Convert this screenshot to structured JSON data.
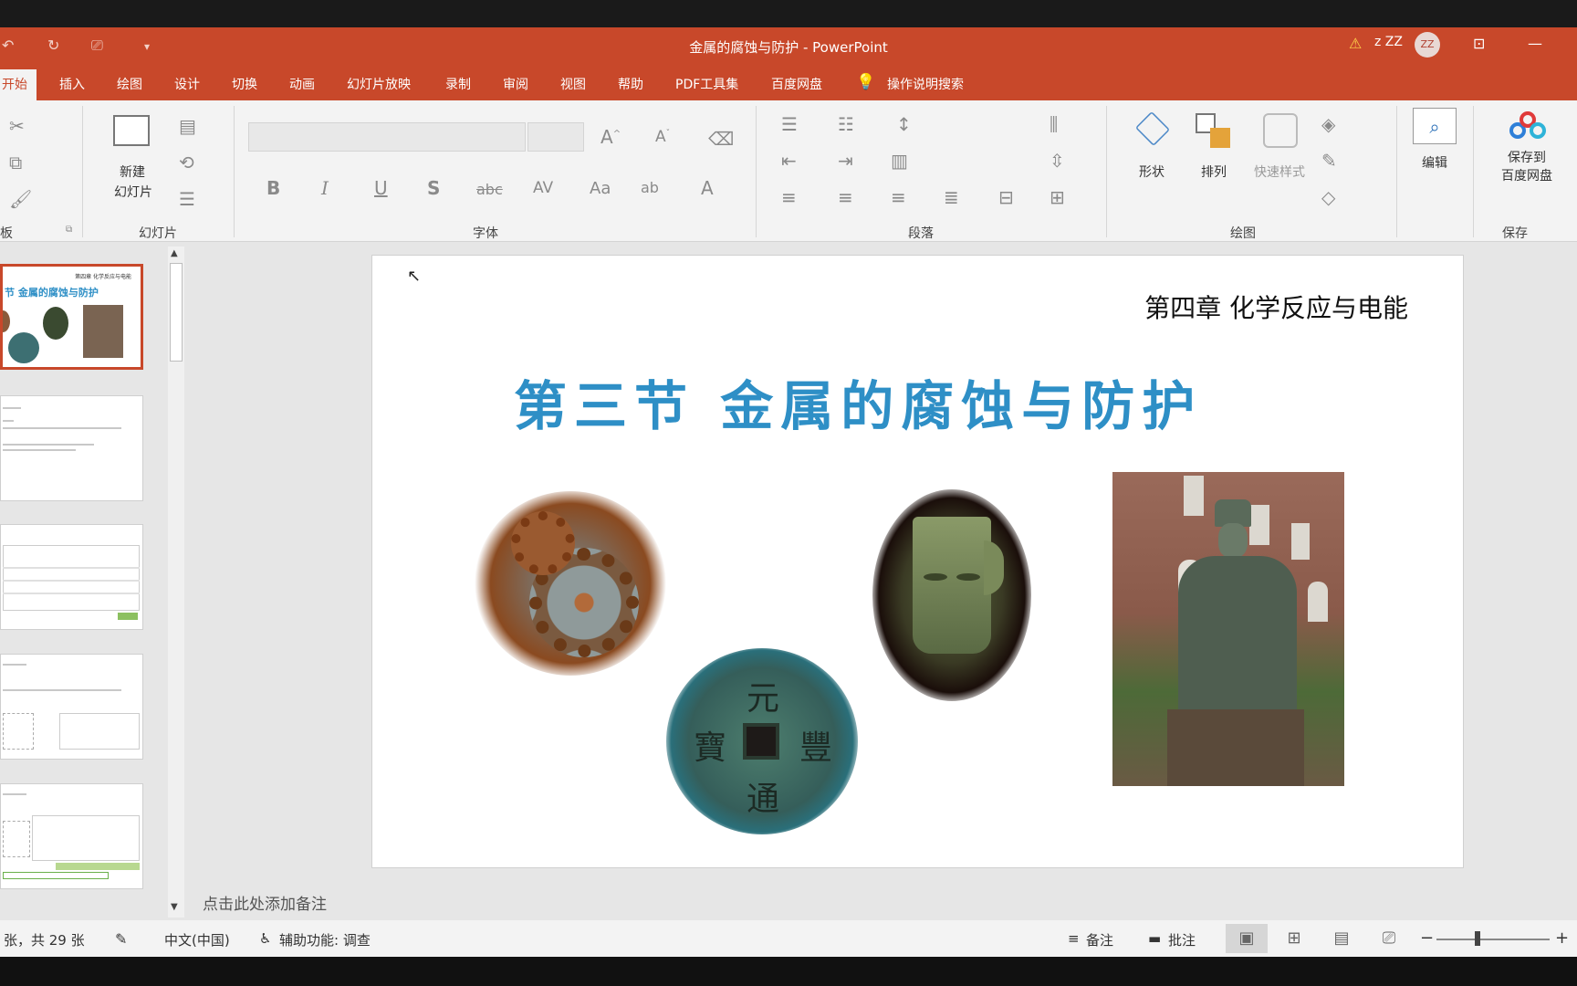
{
  "window": {
    "title": "金属的腐蚀与防护  -  PowerPoint",
    "user": "z ZZ",
    "avatar_initials": "ZZ"
  },
  "tabs": [
    {
      "label": "开始",
      "active": true
    },
    {
      "label": "插入"
    },
    {
      "label": "绘图"
    },
    {
      "label": "设计"
    },
    {
      "label": "切换"
    },
    {
      "label": "动画"
    },
    {
      "label": "幻灯片放映"
    },
    {
      "label": "录制"
    },
    {
      "label": "审阅"
    },
    {
      "label": "视图"
    },
    {
      "label": "帮助"
    },
    {
      "label": "PDF工具集"
    },
    {
      "label": "百度网盘"
    },
    {
      "label": "操作说明搜索"
    }
  ],
  "ribbon": {
    "groups": {
      "clipboard": "板",
      "slides": "幻灯片",
      "font": "字体",
      "paragraph": "段落",
      "drawing": "绘图",
      "save": "保存"
    },
    "new_slide_line1": "新建",
    "new_slide_line2": "幻灯片",
    "shapes": "形状",
    "arrange": "排列",
    "quick_styles": "快速样式",
    "edit": "编辑",
    "save_to_line1": "保存到",
    "save_to_line2": "百度网盘",
    "font_buttons": [
      "B",
      "I",
      "U",
      "S",
      "abc",
      "AV",
      "Aa",
      "ab",
      "A"
    ]
  },
  "slide": {
    "chapter": "第四章   化学反应与电能",
    "heading": "第三节    金属的腐蚀与防护",
    "images": [
      "rusty-gears",
      "ancient-coin",
      "bronze-mask",
      "bronze-statue"
    ],
    "coin_characters": [
      "元",
      "豐",
      "通",
      "寶"
    ]
  },
  "thumbnails": {
    "thumb1_title": "节    金属的腐蚀与防护",
    "thumb1_header": "第四章  化学反应与电能"
  },
  "notes_placeholder": "点击此处添加备注",
  "status": {
    "slide_count": "张，共 29 张",
    "language": "中文(中国)",
    "accessibility": "辅助功能: 调查",
    "notes": "备注",
    "comments": "批注"
  },
  "colors": {
    "accent": "#c8482a",
    "heading": "#2e8fc6"
  }
}
